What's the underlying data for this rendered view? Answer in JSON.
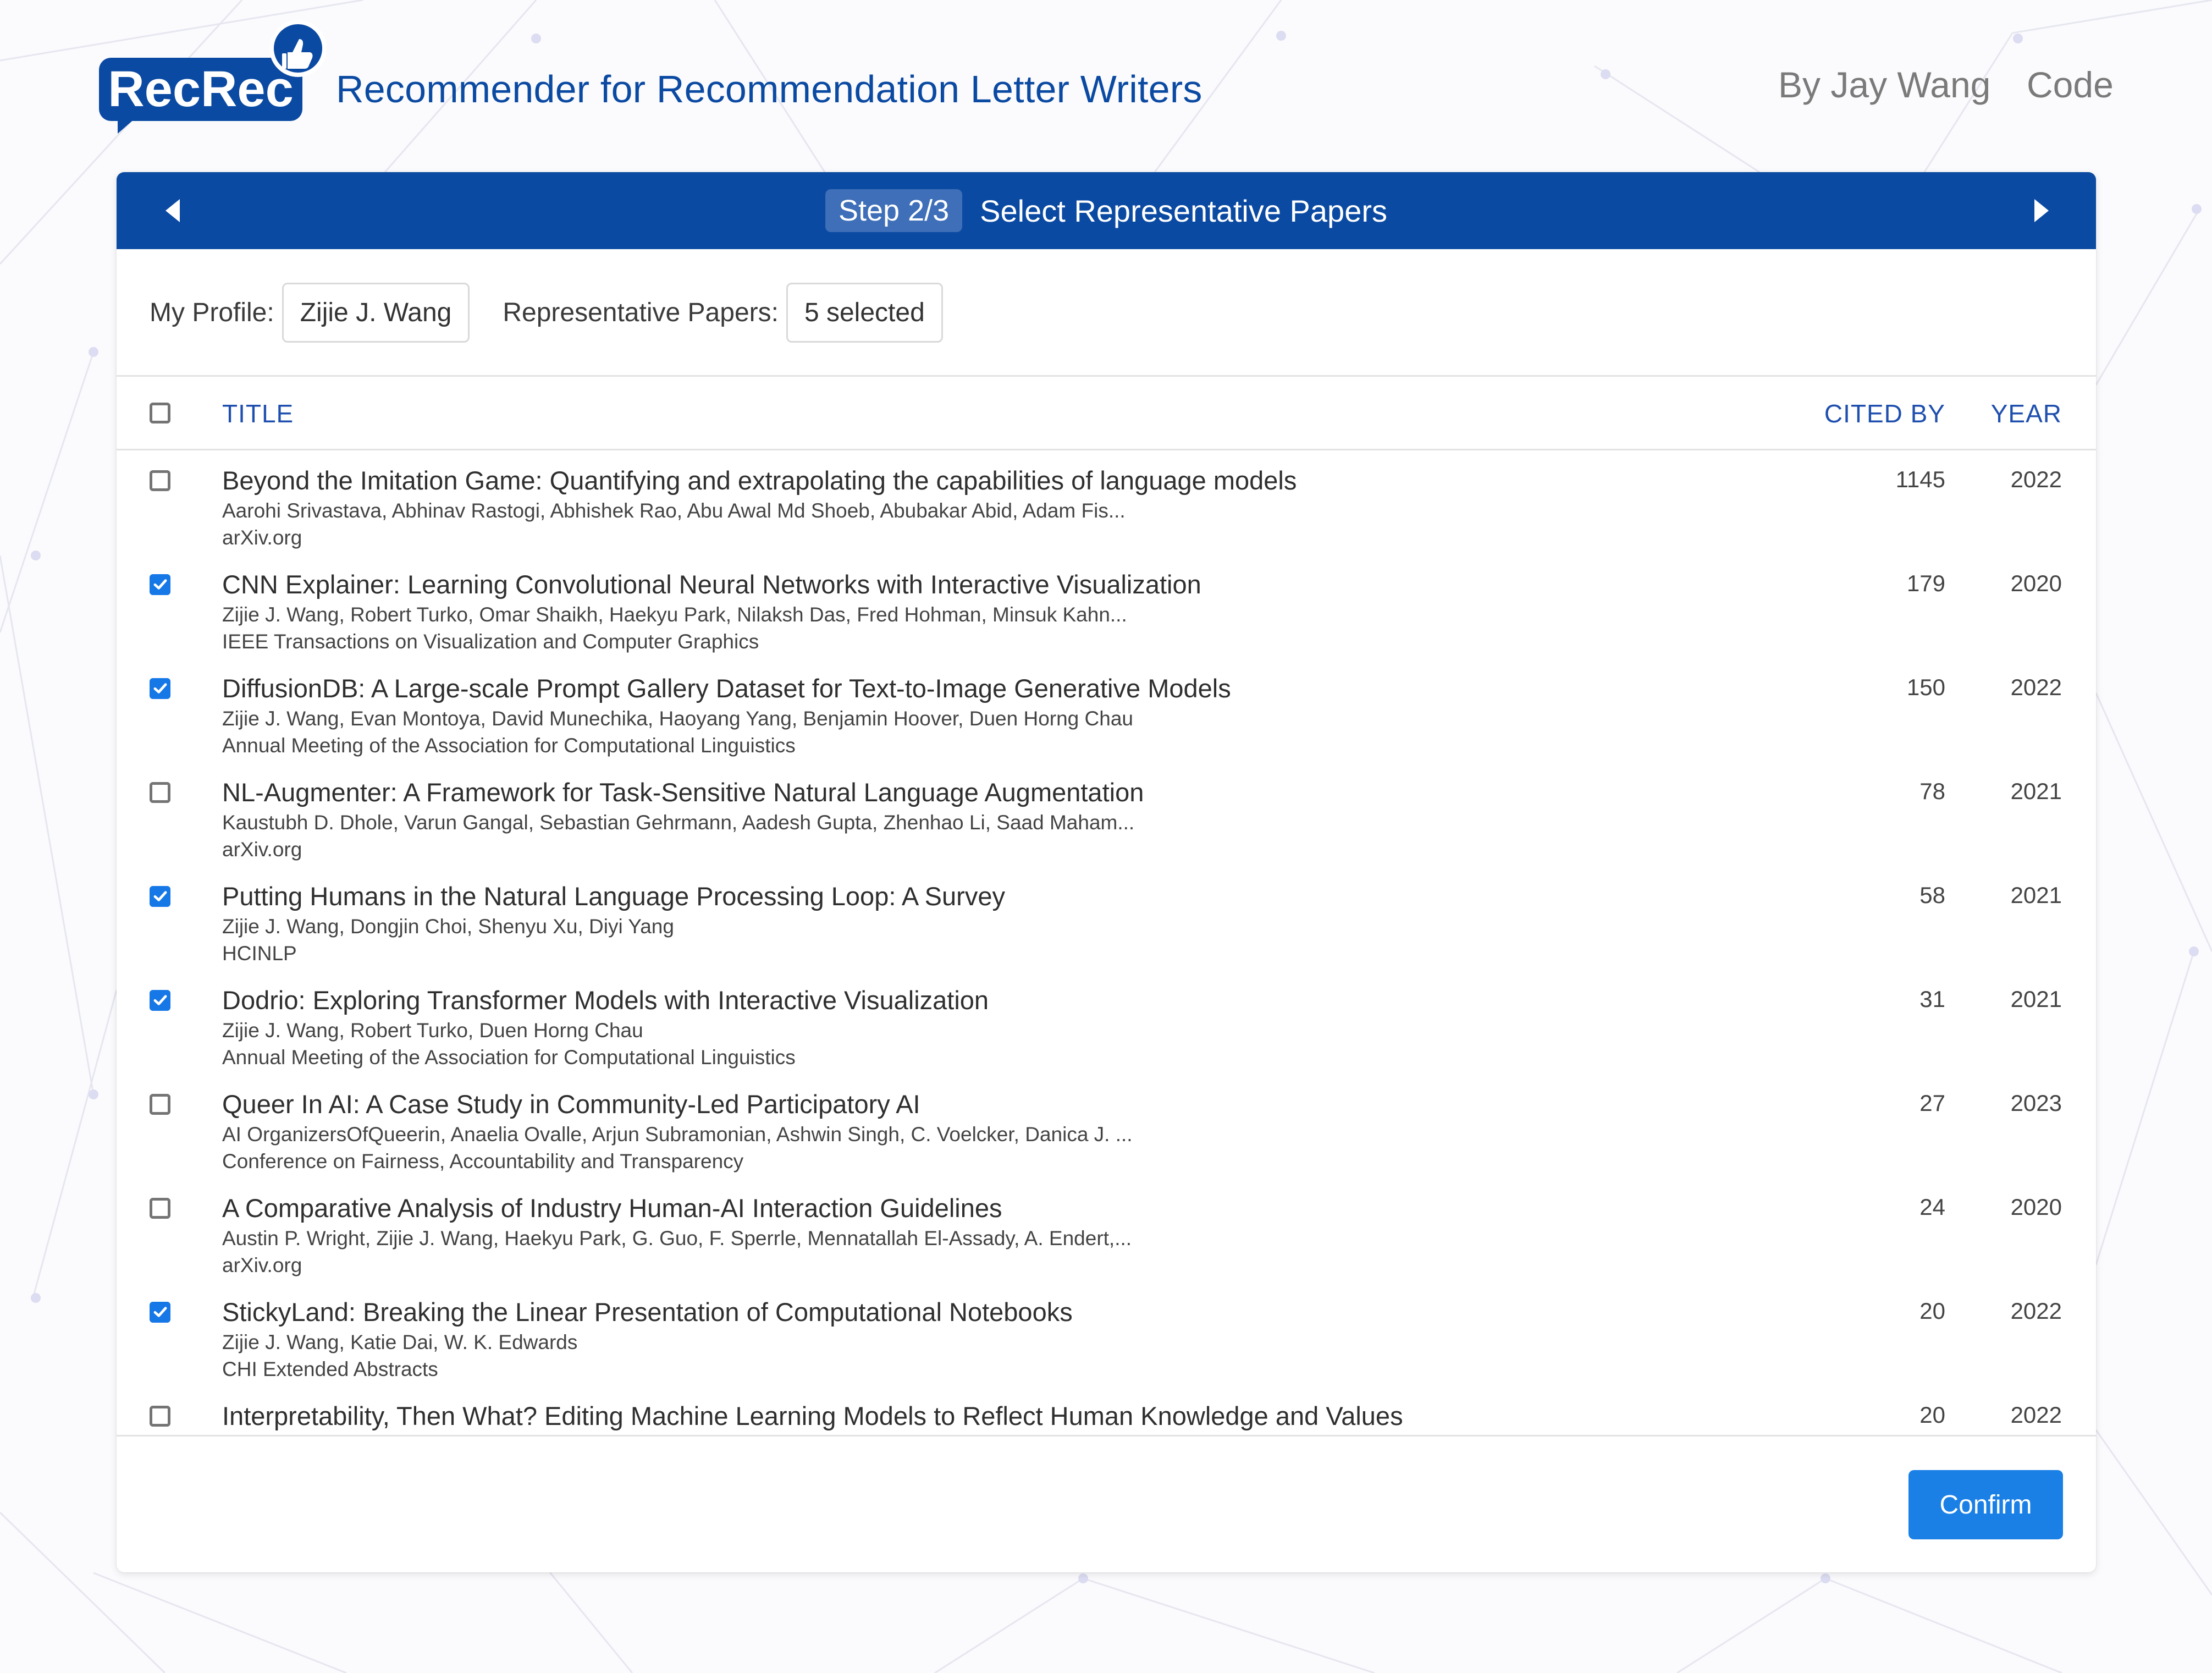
{
  "brand": {
    "logo_text": "RecRec",
    "title": "Recommender for Recommendation Letter Writers",
    "primary_color": "#0b4aa2",
    "logo_icon": "thumbs-up-icon"
  },
  "nav": {
    "author": "By Jay Wang",
    "code": "Code"
  },
  "stepper": {
    "step": "Step 2/3",
    "title": "Select Representative Papers",
    "prev_icon": "arrow-left-icon",
    "next_icon": "arrow-right-icon"
  },
  "profile": {
    "label": "My Profile:",
    "value": "Zijie J. Wang",
    "papers_label": "Representative Papers:",
    "papers_value": "5 selected"
  },
  "table": {
    "headers": {
      "title": "TITLE",
      "cited_by": "CITED BY",
      "year": "YEAR"
    },
    "rows": [
      {
        "checked": false,
        "title": "Beyond the Imitation Game: Quantifying and extrapolating the capabilities of language models",
        "authors": "Aarohi Srivastava, Abhinav Rastogi, Abhishek Rao, Abu Awal Md Shoeb, Abubakar Abid, Adam Fis...",
        "venue": "arXiv.org",
        "cited": "1145",
        "year": "2022"
      },
      {
        "checked": true,
        "title": "CNN Explainer: Learning Convolutional Neural Networks with Interactive Visualization",
        "authors": "Zijie J. Wang, Robert Turko, Omar Shaikh, Haekyu Park, Nilaksh Das, Fred Hohman, Minsuk Kahn...",
        "venue": "IEEE Transactions on Visualization and Computer Graphics",
        "cited": "179",
        "year": "2020"
      },
      {
        "checked": true,
        "title": "DiffusionDB: A Large-scale Prompt Gallery Dataset for Text-to-Image Generative Models",
        "authors": "Zijie J. Wang, Evan Montoya, David Munechika, Haoyang Yang, Benjamin Hoover, Duen Horng Chau",
        "venue": "Annual Meeting of the Association for Computational Linguistics",
        "cited": "150",
        "year": "2022"
      },
      {
        "checked": false,
        "title": "NL-Augmenter: A Framework for Task-Sensitive Natural Language Augmentation",
        "authors": "Kaustubh D. Dhole, Varun Gangal, Sebastian Gehrmann, Aadesh Gupta, Zhenhao Li, Saad Maham...",
        "venue": "arXiv.org",
        "cited": "78",
        "year": "2021"
      },
      {
        "checked": true,
        "title": "Putting Humans in the Natural Language Processing Loop: A Survey",
        "authors": "Zijie J. Wang, Dongjin Choi, Shenyu Xu, Diyi Yang",
        "venue": "HCINLP",
        "cited": "58",
        "year": "2021"
      },
      {
        "checked": true,
        "title": "Dodrio: Exploring Transformer Models with Interactive Visualization",
        "authors": "Zijie J. Wang, Robert Turko, Duen Horng Chau",
        "venue": "Annual Meeting of the Association for Computational Linguistics",
        "cited": "31",
        "year": "2021"
      },
      {
        "checked": false,
        "title": "Queer In AI: A Case Study in Community-Led Participatory AI",
        "authors": "AI OrganizersOfQueerin, Anaelia Ovalle, Arjun Subramonian, Ashwin Singh, C. Voelcker, Danica J. ...",
        "venue": "Conference on Fairness, Accountability and Transparency",
        "cited": "27",
        "year": "2023"
      },
      {
        "checked": false,
        "title": "A Comparative Analysis of Industry Human-AI Interaction Guidelines",
        "authors": "Austin P. Wright, Zijie J. Wang, Haekyu Park, G. Guo, F. Sperrle, Mennatallah El-Assady, A. Endert,...",
        "venue": "arXiv.org",
        "cited": "24",
        "year": "2020"
      },
      {
        "checked": true,
        "title": "StickyLand: Breaking the Linear Presentation of Computational Notebooks",
        "authors": "Zijie J. Wang, Katie Dai, W. K. Edwards",
        "venue": "CHI Extended Abstracts",
        "cited": "20",
        "year": "2022"
      },
      {
        "checked": false,
        "title": "Interpretability, Then What? Editing Machine Learning Models to Reflect Human Knowledge and Values",
        "authors": "",
        "venue": "",
        "cited": "20",
        "year": "2022"
      }
    ]
  },
  "actions": {
    "confirm": "Confirm",
    "confirm_color": "#1a80e6"
  }
}
